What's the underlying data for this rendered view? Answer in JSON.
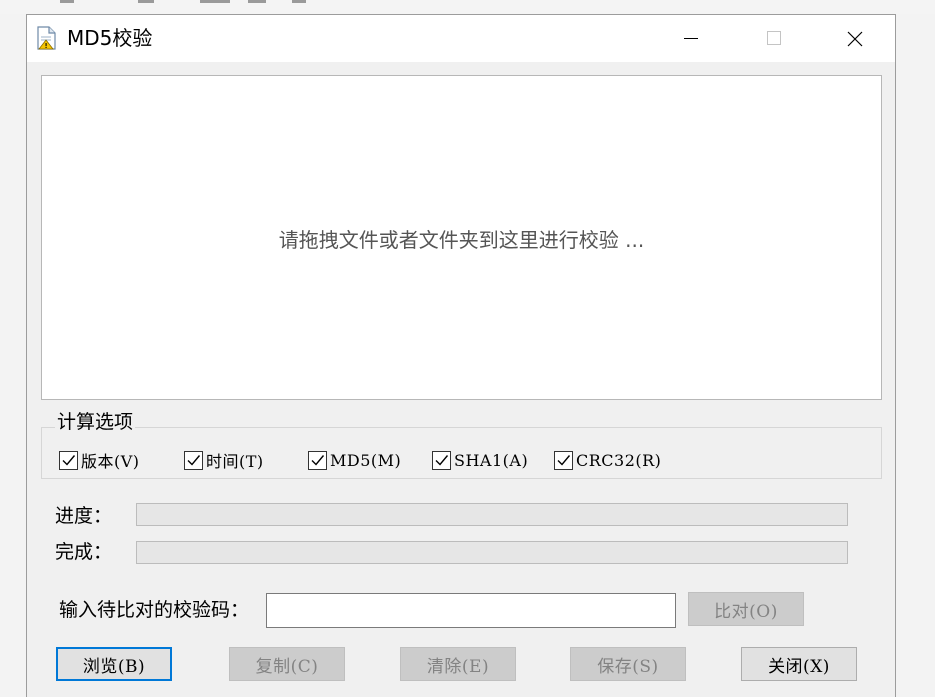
{
  "window": {
    "title": "MD5校验"
  },
  "drop_area": {
    "hint": "请拖拽文件或者文件夹到这里进行校验 ..."
  },
  "options": {
    "group_title": "计算选项",
    "items": [
      {
        "label": "版本(V)",
        "checked": true
      },
      {
        "label": "时间(T)",
        "checked": true
      },
      {
        "label": "MD5(M)",
        "checked": true
      },
      {
        "label": "SHA1(A)",
        "checked": true
      },
      {
        "label": "CRC32(R)",
        "checked": true
      }
    ]
  },
  "progress": {
    "label": "进度：",
    "value": 0
  },
  "complete": {
    "label": "完成：",
    "value": 0
  },
  "compare": {
    "label": "输入待比对的校验码：",
    "value": "",
    "button": "比对(O)",
    "button_enabled": false
  },
  "buttons": {
    "browse": "浏览(B)",
    "copy": "复制(C)",
    "clear": "清除(E)",
    "save": "保存(S)",
    "close": "关闭(X)"
  }
}
